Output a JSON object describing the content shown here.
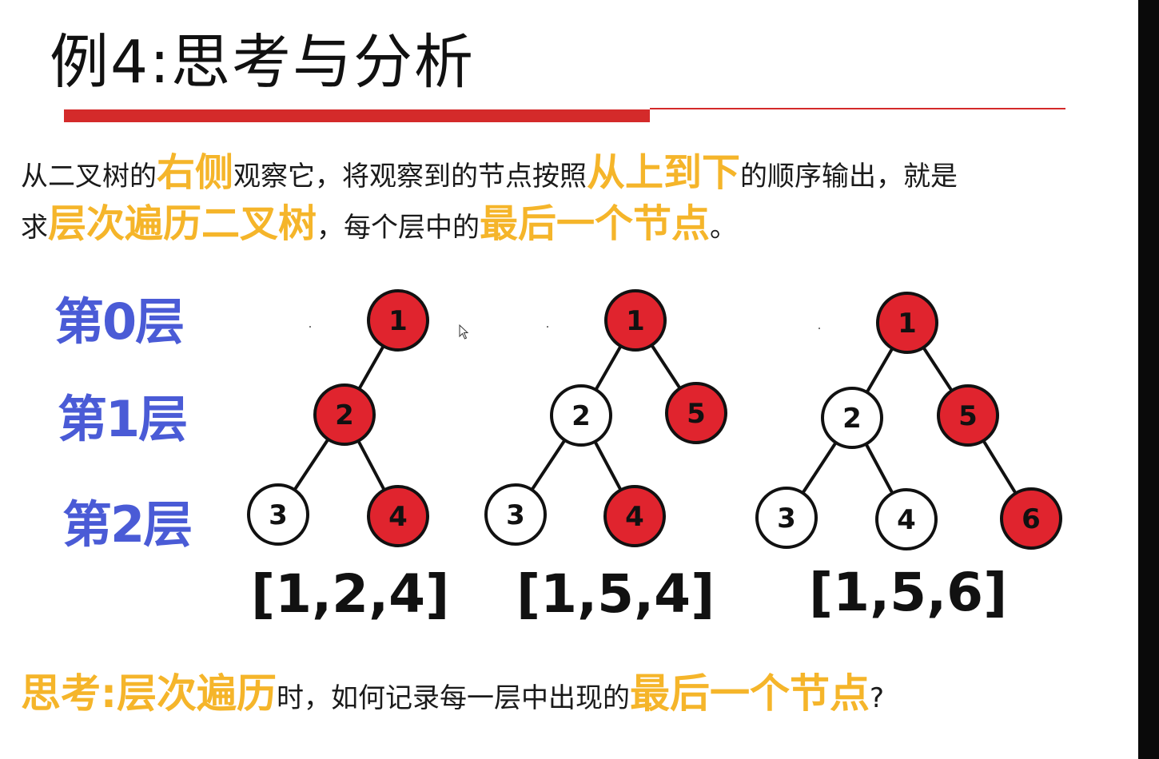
{
  "title": "例4:思考与分析",
  "intro": {
    "line1": [
      {
        "text": "从二叉树的",
        "hl": false
      },
      {
        "text": "右侧",
        "hl": true
      },
      {
        "text": "观察它，将观察到的节点按照",
        "hl": false
      },
      {
        "text": "从上到下",
        "hl": true
      },
      {
        "text": "的顺序输出，就是",
        "hl": false
      }
    ],
    "line2": [
      {
        "text": "求",
        "hl": false
      },
      {
        "text": "层次遍历二叉树",
        "hl": true
      },
      {
        "text": "，每个层中的",
        "hl": false
      },
      {
        "text": "最后一个节点",
        "hl": true
      },
      {
        "text": "。",
        "hl": false
      }
    ]
  },
  "levels": [
    "第0层",
    "第1层",
    "第2层"
  ],
  "trees": [
    {
      "result": "[1,2,4]",
      "nodes": [
        {
          "label": "1",
          "highlight": true
        },
        {
          "label": "2",
          "highlight": true
        },
        {
          "label": "3",
          "highlight": false
        },
        {
          "label": "4",
          "highlight": true
        }
      ]
    },
    {
      "result": "[1,5,4]",
      "nodes": [
        {
          "label": "1",
          "highlight": true
        },
        {
          "label": "2",
          "highlight": false
        },
        {
          "label": "5",
          "highlight": true
        },
        {
          "label": "3",
          "highlight": false
        },
        {
          "label": "4",
          "highlight": true
        }
      ]
    },
    {
      "result": "[1,5,6]",
      "nodes": [
        {
          "label": "1",
          "highlight": true
        },
        {
          "label": "2",
          "highlight": false
        },
        {
          "label": "5",
          "highlight": true
        },
        {
          "label": "3",
          "highlight": false
        },
        {
          "label": "4",
          "highlight": false
        },
        {
          "label": "6",
          "highlight": true
        }
      ]
    }
  ],
  "question": [
    {
      "text": "思考:层次遍历",
      "hl": true
    },
    {
      "text": "时，如何记录每一层中出现的",
      "hl": false
    },
    {
      "text": "最后一个节点",
      "hl": true
    },
    {
      "text": "?",
      "hl": false
    }
  ],
  "colors": {
    "node_highlight": "#e0242e",
    "accent_bar": "#d42a2a",
    "highlight_text": "#f5b52a",
    "level_label": "#4a5bd6"
  }
}
